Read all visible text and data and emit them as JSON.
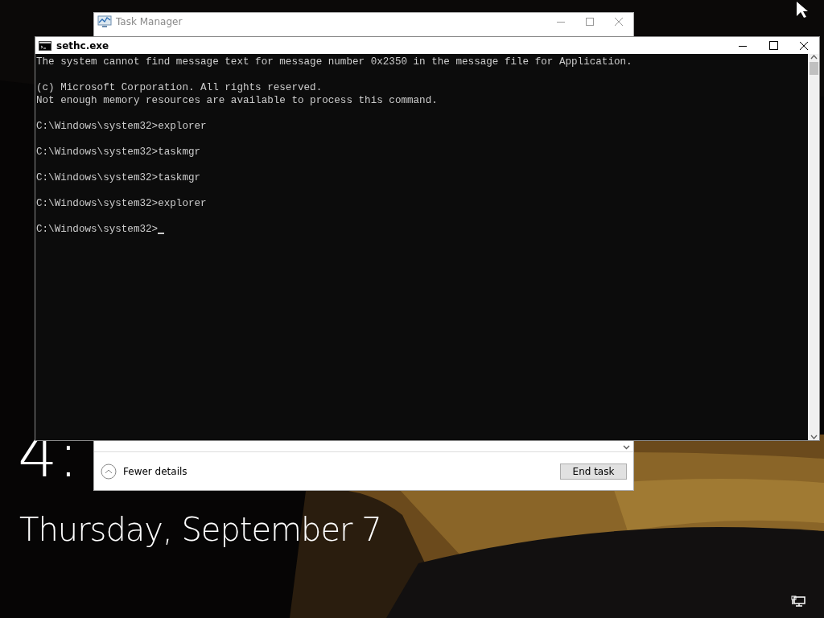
{
  "lock_screen": {
    "time": "4:",
    "date": "Thursday, September 7"
  },
  "task_manager": {
    "title": "Task Manager",
    "fewer_details": "Fewer details",
    "end_task": "End task"
  },
  "console": {
    "title": "sethc.exe",
    "blocks": [
      [
        "The system cannot find message text for message number 0x2350 in the message file for Application."
      ],
      [
        "(c) Microsoft Corporation. All rights reserved.",
        "Not enough memory resources are available to process this command."
      ],
      [
        "C:\\Windows\\system32>explorer"
      ],
      [
        "C:\\Windows\\system32>taskmgr"
      ],
      [
        "C:\\Windows\\system32>taskmgr"
      ],
      [
        "C:\\Windows\\system32>explorer"
      ],
      [
        "C:\\Windows\\system32>"
      ]
    ]
  }
}
